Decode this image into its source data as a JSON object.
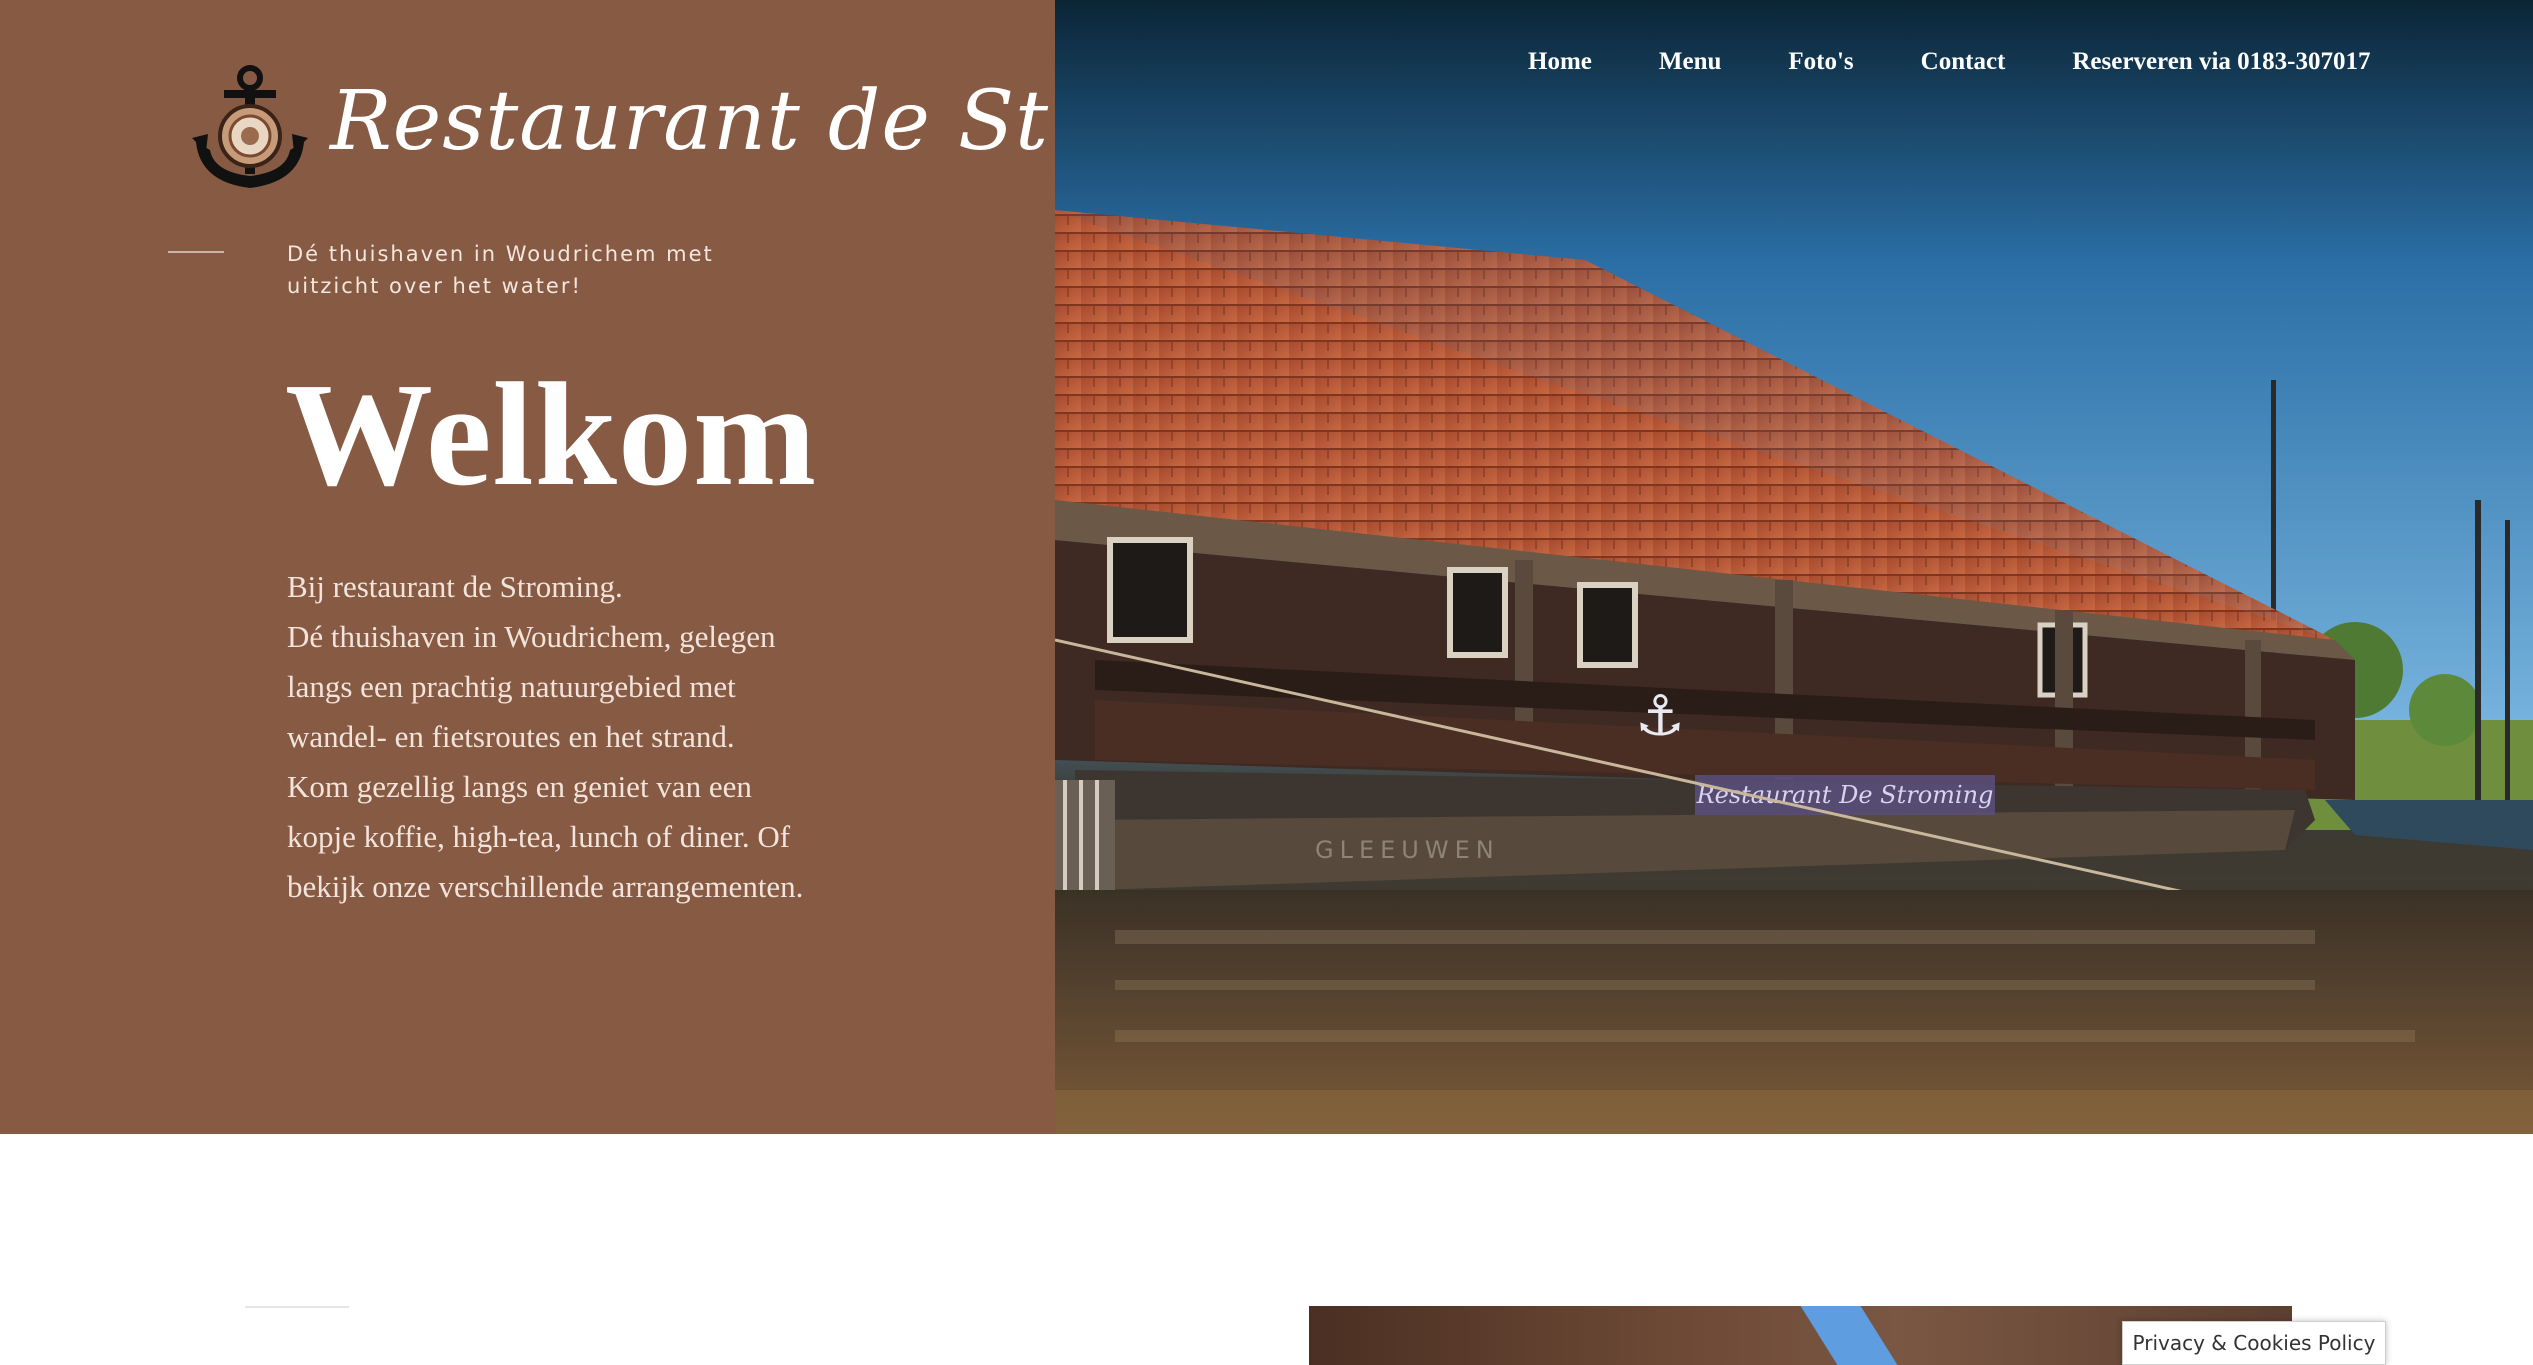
{
  "brand": {
    "name": "Restaurant de Stroming",
    "logo_icon": "anchor-emblem-icon"
  },
  "nav": {
    "items": [
      {
        "label": "Home"
      },
      {
        "label": "Menu"
      },
      {
        "label": "Foto's"
      },
      {
        "label": "Contact"
      },
      {
        "label": "Reserveren via 0183-307017"
      }
    ]
  },
  "hero": {
    "tagline": "Dé thuishaven in Woudrichem met uitzicht over het water!",
    "title": "Welkom",
    "intro_lines": [
      "Bij restaurant de Stroming.",
      "Dé thuishaven in Woudrichem, gelegen langs een prachtig natuurgebied met wandel- en fietsroutes en het strand.",
      "Kom gezellig langs en geniet van een kopje koffie, high-tea, lunch of diner. Of bekijk onze verschillende arrangementen."
    ],
    "photo_sign": "Restaurant De Stroming",
    "photo_hull_text": "GLEEUWEN"
  },
  "cookie_banner": {
    "label": "Privacy & Cookies Policy"
  },
  "colors": {
    "panel_brown": "#875a43",
    "text_white": "#ffffff"
  }
}
